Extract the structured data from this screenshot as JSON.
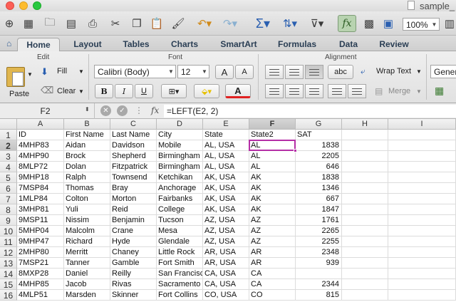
{
  "window": {
    "title": "sample_"
  },
  "toolbar": {
    "zoom": "100%",
    "icons": [
      "new-icon",
      "templates-icon",
      "open-icon",
      "save-icon",
      "print-icon",
      "cut-icon",
      "copy-icon",
      "paste-icon",
      "format-painter-icon",
      "undo-icon",
      "redo-icon",
      "autosum-icon",
      "sort-icon",
      "filter-icon",
      "formula-builder-icon",
      "gallery-icon",
      "toolbox-icon"
    ]
  },
  "tabs": [
    "Home",
    "Layout",
    "Tables",
    "Charts",
    "SmartArt",
    "Formulas",
    "Data",
    "Review"
  ],
  "ribbon": {
    "edit": {
      "label": "Edit",
      "paste": "Paste",
      "fill": "Fill",
      "clear": "Clear"
    },
    "font": {
      "label": "Font",
      "name": "Calibri (Body)",
      "size": "12",
      "bold": "B",
      "italic": "I",
      "underline": "U",
      "font_color": "A",
      "grow": "A",
      "shrink": "A"
    },
    "alignment": {
      "label": "Alignment",
      "abc": "abc",
      "wrap_text": "Wrap Text",
      "merge": "Merge"
    },
    "number": {
      "format": "Gener"
    }
  },
  "formula_bar": {
    "cell_ref": "F2",
    "fx": "fx",
    "formula": "=LEFT(E2, 2)"
  },
  "sheet": {
    "columns": [
      "A",
      "B",
      "C",
      "D",
      "E",
      "F",
      "G",
      "H",
      "I"
    ],
    "selected_column": "F",
    "selected_row": "2",
    "rows": [
      {
        "n": "1",
        "cells": [
          "ID",
          "First Name",
          "Last Name",
          "City",
          "State",
          "State2",
          "SAT"
        ]
      },
      {
        "n": "2",
        "cells": [
          "4MHP83",
          "Aidan",
          "Davidson",
          "Mobile",
          "AL, USA",
          "AL",
          "1838"
        ]
      },
      {
        "n": "3",
        "cells": [
          "4MHP90",
          " Brock",
          "Shepherd",
          "Birmingham",
          "AL, USA",
          "AL",
          "2205"
        ]
      },
      {
        "n": "4",
        "cells": [
          "8MLP72",
          "Dolan",
          "Fitzpatrick",
          "Birmingham",
          "AL, USA",
          "AL",
          "646"
        ]
      },
      {
        "n": "5",
        "cells": [
          "9MHP18",
          "Ralph",
          "Townsend",
          "Ketchikan",
          "AK, USA",
          "AK",
          "1838"
        ]
      },
      {
        "n": "6",
        "cells": [
          "7MSP84",
          "Thomas",
          "Bray",
          "Anchorage",
          "AK, USA",
          "AK",
          "1346"
        ]
      },
      {
        "n": "7",
        "cells": [
          "1MLP84",
          "Colton",
          "Morton",
          "Fairbanks",
          "AK, USA",
          "AK",
          "667"
        ]
      },
      {
        "n": "8",
        "cells": [
          "3MHP81",
          "Yuli",
          "Reid",
          "College",
          "AK, USA",
          "AK",
          "1847"
        ]
      },
      {
        "n": "9",
        "cells": [
          "9MSP11",
          "Nissim",
          "Benjamin",
          "Tucson",
          "AZ, USA",
          "AZ",
          "1761"
        ]
      },
      {
        "n": "10",
        "cells": [
          "5MHP04",
          "Malcolm",
          "Crane",
          "Mesa",
          "AZ, USA",
          "AZ",
          "2265"
        ]
      },
      {
        "n": "11",
        "cells": [
          "9MHP47",
          "Richard",
          "Hyde",
          "Glendale",
          "AZ, USA",
          "AZ",
          "2255"
        ]
      },
      {
        "n": "12",
        "cells": [
          "2MHP80",
          "Merritt",
          "Chaney",
          "Little Rock",
          "AR, USA",
          "AR",
          "2348"
        ]
      },
      {
        "n": "13",
        "cells": [
          "7MSP21",
          "Tanner",
          "Gamble",
          "Fort Smith",
          "AR, USA",
          "AR",
          "939"
        ]
      },
      {
        "n": "14",
        "cells": [
          "8MXP28",
          "Daniel",
          "Reilly",
          "San Francisco",
          "CA, USA",
          "CA",
          ""
        ]
      },
      {
        "n": "15",
        "cells": [
          "4MHP85",
          "Jacob",
          "Rivas",
          "Sacramento",
          "CA, USA",
          "CA",
          "2344"
        ]
      },
      {
        "n": "16",
        "cells": [
          "4MLP51",
          "Marsden",
          "Skinner",
          "Fort Collins",
          "CO, USA",
          "CO",
          "815"
        ]
      }
    ]
  },
  "colors": {
    "accent_selection": "#b52fa6",
    "fx_active": "#b8d3b0",
    "font_color_bar": "#e02020"
  }
}
